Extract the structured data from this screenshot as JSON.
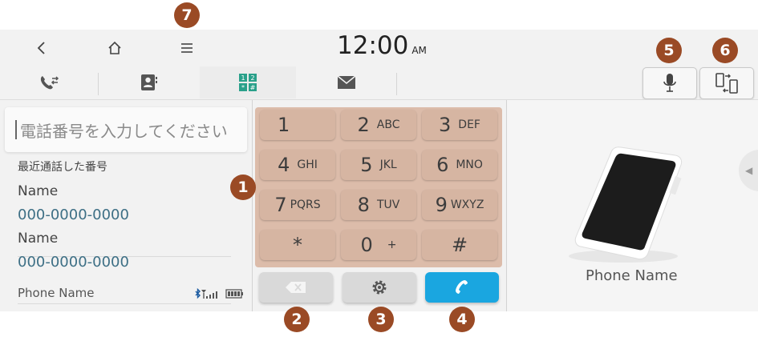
{
  "status": {
    "time": "12:00",
    "ampm": "AM"
  },
  "tabs": [
    {
      "name": "call-history-icon"
    },
    {
      "name": "contacts-icon"
    },
    {
      "name": "dialpad-icon",
      "active": true
    },
    {
      "name": "message-icon"
    }
  ],
  "dial": {
    "placeholder": "電話番号を入力してください"
  },
  "recent": {
    "title": "最近通話した番号",
    "items": [
      {
        "name": "Name",
        "number": "000-0000-0000"
      },
      {
        "name": "Name",
        "number": "000-0000-0000"
      }
    ]
  },
  "phone": {
    "name": "Phone Name"
  },
  "keypad": {
    "keys": [
      {
        "num": "1",
        "letters": ""
      },
      {
        "num": "2",
        "letters": "ABC"
      },
      {
        "num": "3",
        "letters": "DEF"
      },
      {
        "num": "4",
        "letters": "GHI"
      },
      {
        "num": "5",
        "letters": "JKL"
      },
      {
        "num": "6",
        "letters": "MNO"
      },
      {
        "num": "7",
        "letters": "PQRS"
      },
      {
        "num": "8",
        "letters": "TUV"
      },
      {
        "num": "9",
        "letters": "WXYZ"
      },
      {
        "num": "*",
        "letters": ""
      },
      {
        "num": "0",
        "letters": "+"
      },
      {
        "num": "#",
        "letters": ""
      }
    ]
  },
  "device": {
    "label": "Phone Name"
  },
  "callouts": [
    "1",
    "2",
    "3",
    "4",
    "5",
    "6",
    "7"
  ],
  "colors": {
    "keypad": "#d6b5a2",
    "call_button": "#1aa6e0",
    "callout": "#9a4a25",
    "number_text": "#3d6f85"
  }
}
